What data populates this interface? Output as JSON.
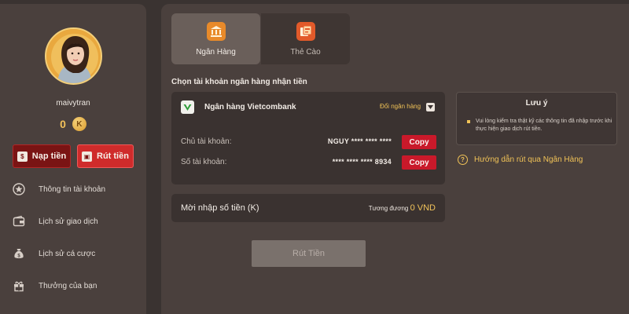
{
  "sidebar": {
    "username": "maivytran",
    "balance": "0",
    "coin_label": "K",
    "deposit_label": "Nạp tiền",
    "withdraw_label": "Rút tiền",
    "menu": [
      {
        "label": "Thông tin tài khoản",
        "icon": "profile-star-icon"
      },
      {
        "label": "Lịch sử giao dịch",
        "icon": "wallet-icon"
      },
      {
        "label": "Lịch sử cá cược",
        "icon": "money-bag-icon"
      },
      {
        "label": "Thưởng của bạn",
        "icon": "gift-icon"
      }
    ]
  },
  "tabs": [
    {
      "label": "Ngân Hàng",
      "icon": "bank-icon",
      "active": true
    },
    {
      "label": "Thẻ Cào",
      "icon": "scratch-card-icon",
      "active": false
    }
  ],
  "form": {
    "section_title": "Chọn tài khoản ngân hàng nhận tiền",
    "bank_name": "Ngân hàng Vietcombank",
    "change_bank": "Đổi ngân hàng",
    "holder_label": "Chủ tài khoản:",
    "holder_value": "NGUY **** **** ****",
    "account_label": "Số tài khoản:",
    "account_value": "**** **** **** 8934",
    "copy_label": "Copy",
    "amount_label": "Mời nhập số tiền (K)",
    "equiv_label": "Tương đương",
    "equiv_value": "0 VND",
    "submit_label": "Rút Tiền"
  },
  "note": {
    "title": "Lưu ý",
    "text": "Vui lòng kiểm tra thật kỹ các thông tin đã nhập trước khi thực hiện giao dịch rút tiền."
  },
  "guide_label": "Hướng dẫn rút qua Ngân Hàng",
  "colors": {
    "accent_gold": "#f0c257",
    "copy_red": "#c9192a",
    "background": "#3a3331",
    "panel": "#4a403d"
  }
}
